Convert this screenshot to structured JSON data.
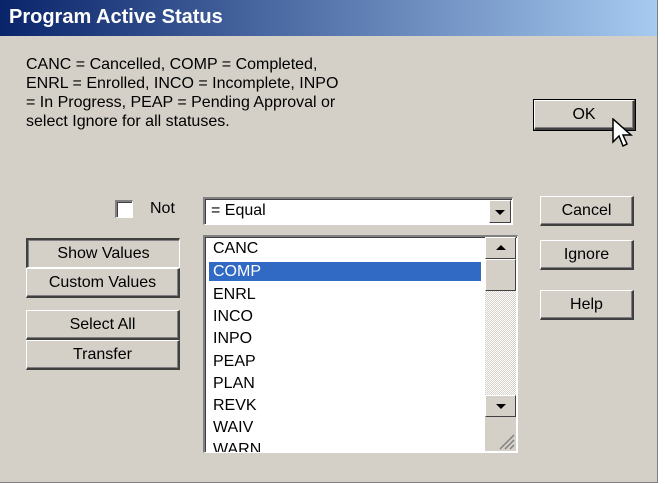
{
  "window": {
    "title": "Program Active Status"
  },
  "description": "CANC = Cancelled, COMP = Completed, ENRL = Enrolled, INCO = Incomplete, INPO = In Progress, PEAP = Pending Approval or select Ignore for all statuses.",
  "not_checkbox": {
    "label": "Not",
    "checked": false
  },
  "operator": {
    "selected": "= Equal"
  },
  "buttons": {
    "ok": "OK",
    "cancel": "Cancel",
    "ignore": "Ignore",
    "help": "Help",
    "show_values": "Show Values",
    "custom_values": "Custom Values",
    "select_all": "Select All",
    "transfer": "Transfer"
  },
  "values_list": {
    "items": [
      "CANC",
      "COMP",
      "ENRL",
      "INCO",
      "INPO",
      "PEAP",
      "PLAN",
      "REVK",
      "WAIV",
      "WARN"
    ],
    "selected_index": 1
  },
  "colors": {
    "selection": "#316ac5",
    "titlebar": "#0a246a"
  }
}
